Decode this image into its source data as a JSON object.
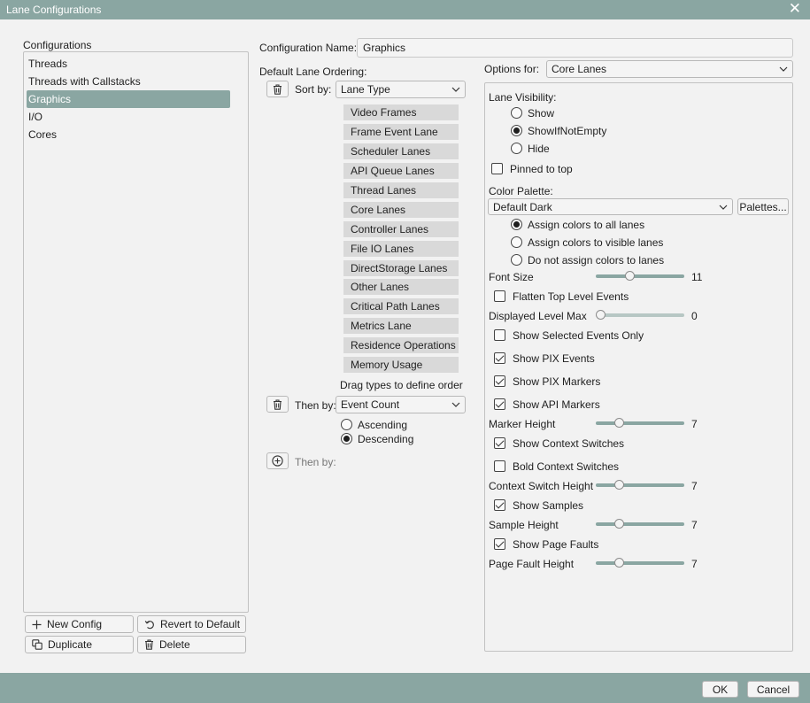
{
  "window": {
    "title": "Lane Configurations",
    "close_icon": "close-icon"
  },
  "configurations": {
    "label": "Configurations",
    "items": [
      "Threads",
      "Threads with Callstacks",
      "Graphics",
      "I/O",
      "Cores"
    ],
    "selected": "Graphics",
    "buttons": {
      "new": "New Config",
      "revert": "Revert to Default",
      "duplicate": "Duplicate",
      "delete": "Delete"
    }
  },
  "config_name": {
    "label": "Configuration Name:",
    "value": "Graphics"
  },
  "ordering": {
    "label": "Default Lane Ordering:",
    "sort_by_label": "Sort by:",
    "sort_by_value": "Lane Type",
    "lane_types": [
      "Video Frames",
      "Frame Event Lane",
      "Scheduler Lanes",
      "API Queue Lanes",
      "Thread Lanes",
      "Core Lanes",
      "Controller Lanes",
      "File IO Lanes",
      "DirectStorage Lanes",
      "Other Lanes",
      "Critical Path Lanes",
      "Metrics Lane",
      "Residence Operations",
      "Memory Usage"
    ],
    "hint": "Drag types to define order",
    "then_by_label": "Then by:",
    "then_by_value": "Event Count",
    "ascending": "Ascending",
    "descending": "Descending",
    "direction_selected": "Descending",
    "then_by_add_label": "Then by:"
  },
  "options": {
    "label": "Options for:",
    "value": "Core Lanes",
    "lane_visibility": {
      "label": "Lane Visibility:",
      "options": [
        "Show",
        "ShowIfNotEmpty",
        "Hide"
      ],
      "selected": "ShowIfNotEmpty"
    },
    "pinned_to_top": {
      "label": "Pinned to top",
      "checked": false
    },
    "color_palette": {
      "label": "Color Palette:",
      "value": "Default Dark",
      "palettes_button": "Palettes...",
      "assign_options": [
        "Assign colors to all lanes",
        "Assign colors to visible lanes",
        "Do not assign colors to lanes"
      ],
      "assign_selected": "Assign colors to all lanes"
    },
    "font_size": {
      "label": "Font Size",
      "value": "11"
    },
    "flatten_top_level_events": {
      "label": "Flatten Top Level Events",
      "checked": false
    },
    "displayed_level_max": {
      "label": "Displayed Level Max",
      "value": "0"
    },
    "show_selected_events_only": {
      "label": "Show Selected Events Only",
      "checked": false
    },
    "show_pix_events": {
      "label": "Show PIX Events",
      "checked": true
    },
    "show_pix_markers": {
      "label": "Show PIX Markers",
      "checked": true
    },
    "show_api_markers": {
      "label": "Show API Markers",
      "checked": true
    },
    "marker_height": {
      "label": "Marker Height",
      "value": "7"
    },
    "show_context_switches": {
      "label": "Show Context Switches",
      "checked": true
    },
    "bold_context_switches": {
      "label": "Bold Context Switches",
      "checked": false
    },
    "context_switch_height": {
      "label": "Context Switch Height",
      "value": "7"
    },
    "show_samples": {
      "label": "Show Samples",
      "checked": true
    },
    "sample_height": {
      "label": "Sample Height",
      "value": "7"
    },
    "show_page_faults": {
      "label": "Show Page Faults",
      "checked": true
    },
    "page_fault_height": {
      "label": "Page Fault Height",
      "value": "7"
    }
  },
  "footer": {
    "ok": "OK",
    "cancel": "Cancel"
  },
  "colors": {
    "accent": "#8aa6a2",
    "background": "#f2f2f2",
    "lane_item_bg": "#d9d9d9"
  }
}
